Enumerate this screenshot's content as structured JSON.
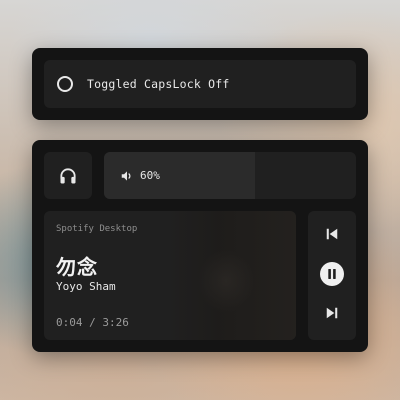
{
  "notification": {
    "text": "Toggled CapsLock Off",
    "icon": "circle-icon"
  },
  "media": {
    "output_icon": "headphones-icon",
    "volume": {
      "icon": "speaker-icon",
      "label": "60%",
      "level": 0.6
    },
    "now_playing": {
      "source": "Spotify Desktop",
      "title": "勿念",
      "artist": "Yoyo Sham",
      "time": "0:04 / 3:26"
    },
    "controls": {
      "previous_icon": "skip-previous-icon",
      "play_pause_icon": "pause-icon",
      "next_icon": "skip-next-icon"
    }
  },
  "colors": {
    "card": "#141414",
    "tile": "#202020",
    "text": "#e8e8e8",
    "muted": "#8e8e8e"
  }
}
